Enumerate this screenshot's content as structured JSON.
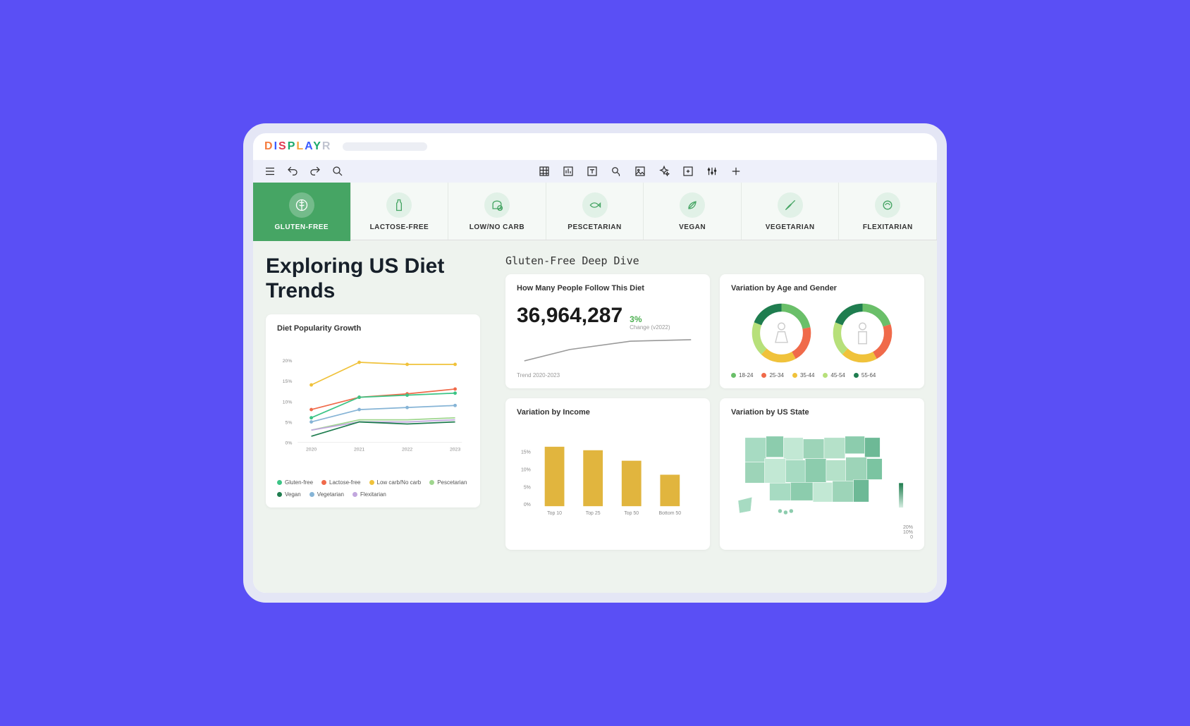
{
  "brand": "DISPLAYR",
  "tabs": [
    {
      "id": "gluten-free",
      "label": "Gluten-Free",
      "active": true
    },
    {
      "id": "lactose-free",
      "label": "Lactose-Free",
      "active": false
    },
    {
      "id": "low-no-carb",
      "label": "Low/No Carb",
      "active": false
    },
    {
      "id": "pescetarian",
      "label": "Pescetarian",
      "active": false
    },
    {
      "id": "vegan",
      "label": "Vegan",
      "active": false
    },
    {
      "id": "vegetarian",
      "label": "Vegetarian",
      "active": false
    },
    {
      "id": "flexitarian",
      "label": "Flexitarian",
      "active": false
    }
  ],
  "page_title": "Exploring US Diet Trends",
  "section_title": "Gluten-Free Deep Dive",
  "popularity_card_title": "Diet Popularity Growth",
  "followers_card": {
    "title": "How Many People Follow This Diet",
    "count": "36,964,287",
    "change_pct": "3%",
    "change_label": "Change (v2022)",
    "trend_label": "Trend 2020-2023"
  },
  "age_gender_card": {
    "title": "Variation by Age and Gender",
    "legend": [
      "18-24",
      "25-34",
      "35-44",
      "45-54",
      "55-64"
    ]
  },
  "income_card": {
    "title": "Variation by Income"
  },
  "state_card": {
    "title": "Variation by US State",
    "scale": [
      "20%",
      "10%",
      "0"
    ]
  },
  "chart_data": [
    {
      "id": "diet_popularity_growth",
      "type": "line",
      "title": "Diet Popularity Growth",
      "xlabel": "",
      "ylabel": "",
      "categories": [
        "2020",
        "2021",
        "2022",
        "2023"
      ],
      "ylim": [
        0,
        20
      ],
      "yticks": [
        "0%",
        "5%",
        "10%",
        "15%",
        "20%"
      ],
      "series": [
        {
          "name": "Gluten-free",
          "color": "#3cc486",
          "values": [
            6,
            11,
            11.5,
            12
          ]
        },
        {
          "name": "Lactose-free",
          "color": "#f06a4a",
          "values": [
            8,
            11,
            11.8,
            13
          ]
        },
        {
          "name": "Low carb/No carb",
          "color": "#f0c23b",
          "values": [
            14,
            19.5,
            19,
            19
          ]
        },
        {
          "name": "Pescetarian",
          "color": "#9fd68e",
          "values": [
            3,
            5.5,
            5.5,
            6
          ]
        },
        {
          "name": "Vegan",
          "color": "#1f7d4f",
          "values": [
            1.5,
            5,
            4.5,
            5
          ]
        },
        {
          "name": "Vegetarian",
          "color": "#86b4d6",
          "values": [
            5,
            8,
            8.5,
            9
          ]
        },
        {
          "name": "Flexitarian",
          "color": "#c2a7de",
          "values": [
            3,
            5,
            5,
            5.5
          ]
        }
      ]
    },
    {
      "id": "followers_trend",
      "type": "line",
      "title": "Trend 2020-2023",
      "categories": [
        "2020",
        "2021",
        "2022",
        "2023"
      ],
      "series": [
        {
          "name": "followers",
          "color": "#999",
          "values": [
            28,
            34,
            36,
            37
          ]
        }
      ]
    },
    {
      "id": "age_female",
      "type": "pie",
      "title": "Female",
      "series": [
        {
          "name": "18-24",
          "color": "#6abf69",
          "value": 22
        },
        {
          "name": "25-34",
          "color": "#f06a4a",
          "value": 20
        },
        {
          "name": "35-44",
          "color": "#f0c23b",
          "value": 20
        },
        {
          "name": "45-54",
          "color": "#b7e07a",
          "value": 19
        },
        {
          "name": "55-64",
          "color": "#1f7d4f",
          "value": 19
        }
      ]
    },
    {
      "id": "age_male",
      "type": "pie",
      "title": "Male",
      "series": [
        {
          "name": "18-24",
          "color": "#6abf69",
          "value": 20
        },
        {
          "name": "25-34",
          "color": "#f06a4a",
          "value": 22
        },
        {
          "name": "35-44",
          "color": "#f0c23b",
          "value": 20
        },
        {
          "name": "45-54",
          "color": "#b7e07a",
          "value": 19
        },
        {
          "name": "55-64",
          "color": "#1f7d4f",
          "value": 19
        }
      ]
    },
    {
      "id": "variation_by_income",
      "type": "bar",
      "title": "Variation by Income",
      "ylim": [
        0,
        20
      ],
      "yticks": [
        "0%",
        "5%",
        "10%",
        "15%"
      ],
      "categories": [
        "Top 10",
        "Top 25",
        "Top 50",
        "Bottom 50"
      ],
      "values": [
        17,
        16,
        13,
        9
      ],
      "color": "#e1b53e"
    },
    {
      "id": "variation_by_state",
      "type": "heatmap",
      "title": "Variation by US State",
      "range": [
        0,
        20
      ],
      "unit": "%"
    }
  ]
}
